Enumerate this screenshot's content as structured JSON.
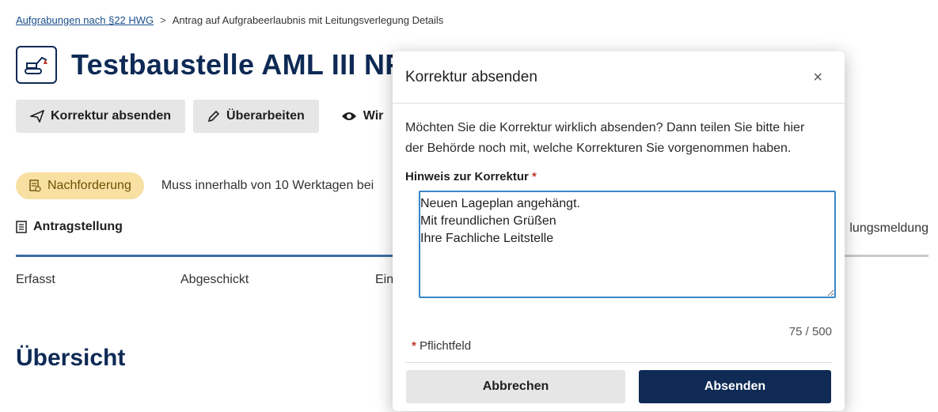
{
  "breadcrumb": {
    "parent_link": "Aufgrabungen nach §22 HWG",
    "separator": ">",
    "current": "Antrag auf Aufgrabeerlaubnis mit Leitungsverlegung Details"
  },
  "header": {
    "title": "Testbaustelle AML III NF"
  },
  "actions": {
    "correction_label": "Korrektur absenden",
    "revise_label": "Überarbeiten",
    "third_label": "Wir"
  },
  "status": {
    "badge": "Nachforderung",
    "deadline_text": "Muss innerhalb von 10 Werktagen bei"
  },
  "tabs": {
    "active": "Antragstellung",
    "right": "lungsmeldung"
  },
  "steps": [
    "Erfasst",
    "Abgeschickt",
    "Ein"
  ],
  "section": {
    "title": "Übersicht"
  },
  "modal": {
    "title": "Korrektur absenden",
    "close_symbol": "×",
    "intro": "Möchten Sie die Korrektur wirklich absenden? Dann teilen Sie bitte hier der Behörde noch mit, welche Korrekturen Sie vorgenommen haben.",
    "field_label": "Hinweis zur Korrektur",
    "required_marker": "*",
    "textarea_value": "Neuen Lageplan angehängt.\nMit freundlichen Grüßen\nIhre Fachliche Leitstelle",
    "counter": "75 / 500",
    "required_note": "Pflichtfeld",
    "cancel_label": "Abbrechen",
    "submit_label": "Absenden"
  },
  "colors": {
    "primary": "#0e2a55",
    "badge_bg": "#f8e0a3",
    "focus": "#3a86c8",
    "required": "#c0392b"
  }
}
